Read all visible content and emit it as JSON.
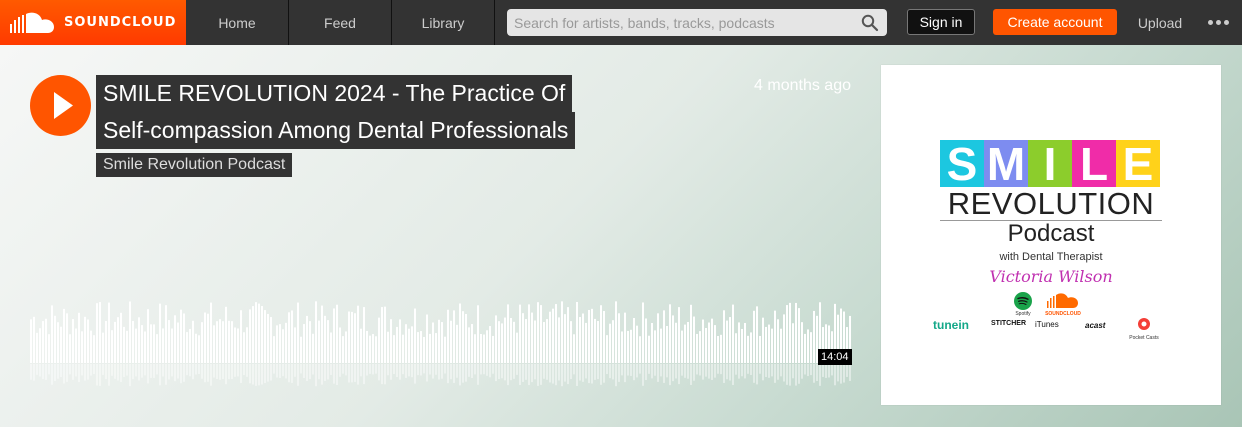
{
  "header": {
    "logo_text": "SOUNDCLOUD",
    "nav": {
      "home": "Home",
      "feed": "Feed",
      "library": "Library"
    },
    "search_placeholder": "Search for artists, bands, tracks, podcasts",
    "sign_in": "Sign in",
    "create_account": "Create account",
    "upload": "Upload"
  },
  "track": {
    "title_line1": "SMILE REVOLUTION 2024 - The Practice Of",
    "title_line2": "Self-compassion Among Dental Professionals",
    "artist": "Smile Revolution Podcast",
    "posted": "4 months ago",
    "duration": "14:04"
  },
  "artwork": {
    "letters": [
      "S",
      "M",
      "I",
      "L",
      "E"
    ],
    "letter_colors": [
      "#1cc7e0",
      "#7d8cf0",
      "#8ccd2c",
      "#f02ca8",
      "#ffd21a"
    ],
    "line2": "REVOLUTION",
    "line3": "Podcast",
    "with_text": "with Dental Therapist",
    "host_name": "Victoria Wilson",
    "spotify_label": "Spotify",
    "soundcloud_label": "SOUNDCLOUD",
    "tunein": "tunein",
    "stitcher": "STITCHER",
    "itunes": "iTunes",
    "acast": "acast",
    "pocketcasts": "Pocket Casts"
  },
  "colors": {
    "brand": "#ff5500",
    "header_bg": "#333333"
  }
}
